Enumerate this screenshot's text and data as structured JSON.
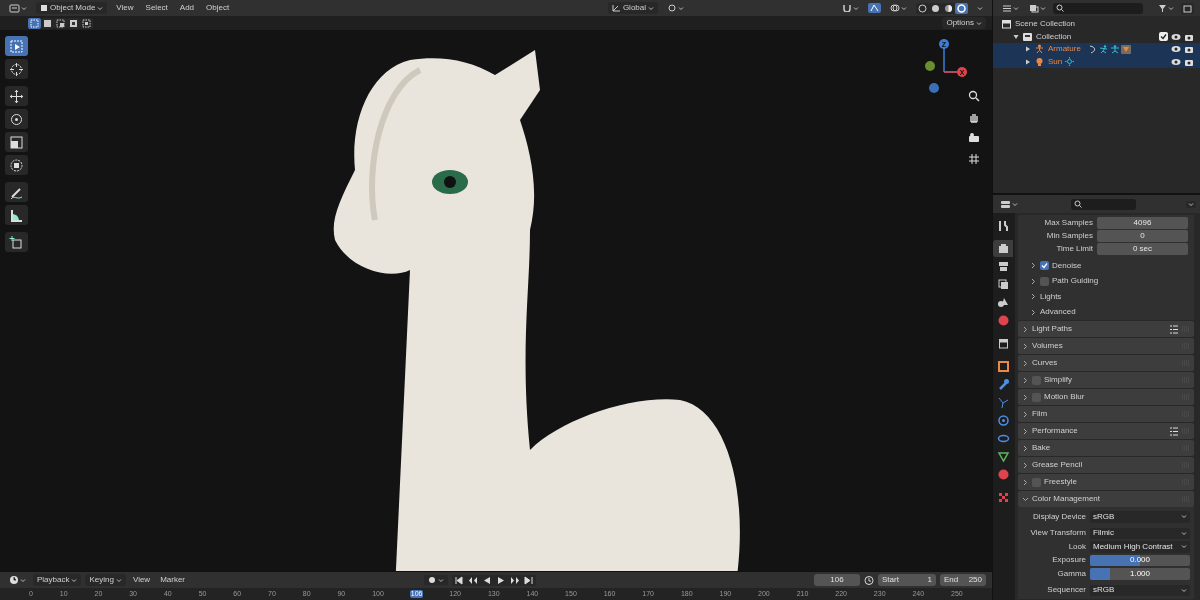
{
  "header": {
    "mode": "Object Mode",
    "menus": [
      "View",
      "Select",
      "Add",
      "Object"
    ],
    "orientation": "Global",
    "options": "Options"
  },
  "select_modes": [
    {
      "selected": true
    },
    {
      "selected": false
    },
    {
      "selected": false
    },
    {
      "selected": false
    },
    {
      "selected": false
    }
  ],
  "shading_modes": [
    {
      "selected": false
    },
    {
      "selected": false
    },
    {
      "selected": false
    },
    {
      "selected": true
    }
  ],
  "tools": [
    {
      "selected": true
    },
    {
      "selected": false
    },
    {
      "selected": false
    },
    {
      "selected": false
    },
    {
      "selected": false
    },
    {
      "selected": false
    },
    {
      "selected": false
    },
    {
      "selected": false
    },
    {
      "selected": false
    }
  ],
  "gizmo": {
    "axes": [
      "Z",
      "X"
    ]
  },
  "outliner": {
    "items": [
      {
        "name": "Scene Collection",
        "kind": "scene",
        "children": [
          {
            "name": "Collection",
            "kind": "collection",
            "checked": true,
            "children": [
              {
                "name": "Armature",
                "kind": "armature",
                "selected": true
              },
              {
                "name": "Sun",
                "kind": "light",
                "selected": true
              }
            ]
          }
        ]
      }
    ]
  },
  "properties": {
    "tabs": [
      {
        "selected": false
      },
      {
        "selected": true
      },
      {
        "selected": false
      },
      {
        "selected": false
      },
      {
        "selected": false
      },
      {
        "selected": false
      },
      {
        "selected": false
      },
      {
        "selected": false
      },
      {
        "selected": false
      },
      {
        "selected": false
      },
      {
        "selected": false
      },
      {
        "selected": false
      },
      {
        "selected": false
      },
      {
        "selected": false
      },
      {
        "selected": false
      }
    ],
    "fields": [
      {
        "label": "Max Samples",
        "value": "4096"
      },
      {
        "label": "Min Samples",
        "value": "0"
      },
      {
        "label": "Time Limit",
        "value": "0 sec"
      }
    ],
    "subpanels": [
      {
        "label": "Denoise",
        "kind": "toggle",
        "checked": true
      },
      {
        "label": "Path Guiding",
        "kind": "toggle",
        "checked": false
      },
      {
        "label": "Lights",
        "kind": "plain"
      },
      {
        "label": "Advanced",
        "kind": "plain"
      }
    ],
    "panels": [
      {
        "label": "Light Paths",
        "kind": "plain",
        "presets": true,
        "expanded": false
      },
      {
        "label": "Volumes",
        "kind": "plain",
        "presets": false,
        "expanded": false
      },
      {
        "label": "Curves",
        "kind": "plain",
        "presets": false,
        "expanded": false
      },
      {
        "label": "Simplify",
        "kind": "toggle",
        "checked": false,
        "presets": false,
        "expanded": false
      },
      {
        "label": "Motion Blur",
        "kind": "toggle",
        "checked": false,
        "presets": false,
        "expanded": false
      },
      {
        "label": "Film",
        "kind": "plain",
        "presets": false,
        "expanded": false
      },
      {
        "label": "Performance",
        "kind": "plain",
        "presets": true,
        "expanded": false
      },
      {
        "label": "Bake",
        "kind": "plain",
        "presets": false,
        "expanded": false
      },
      {
        "label": "Grease Pencil",
        "kind": "plain",
        "presets": false,
        "expanded": false
      },
      {
        "label": "Freestyle",
        "kind": "toggle",
        "checked": false,
        "presets": false,
        "expanded": false
      },
      {
        "label": "Color Management",
        "kind": "plain",
        "presets": false,
        "expanded": true,
        "rows": [
          {
            "label": "Display Device",
            "kind": "dropdown",
            "value": "sRGB"
          },
          {
            "label": "View Transform",
            "kind": "dropdown",
            "value": "Filmic"
          },
          {
            "label": "Look",
            "kind": "dropdown",
            "value": "Medium High Contrast"
          },
          {
            "label": "Exposure",
            "kind": "slider",
            "value": "0.000",
            "level": 0.5
          },
          {
            "label": "Gamma",
            "kind": "slider",
            "value": "1.000",
            "level": 0.2
          },
          {
            "label": "Sequencer",
            "kind": "dropdown",
            "value": "sRGB"
          }
        ]
      }
    ]
  },
  "timeline": {
    "menus": [
      {
        "label": "Playback",
        "dropdown": true
      },
      {
        "label": "Keying",
        "dropdown": true
      },
      {
        "label": "View",
        "dropdown": false
      },
      {
        "label": "Marker",
        "dropdown": false
      }
    ],
    "current_frame": "106",
    "start_label": "Start",
    "start": "1",
    "end_label": "End",
    "end": "250",
    "ruler": [
      {
        "label": "0",
        "selected": false
      },
      {
        "label": "10",
        "selected": false
      },
      {
        "label": "20",
        "selected": false
      },
      {
        "label": "30",
        "selected": false
      },
      {
        "label": "40",
        "selected": false
      },
      {
        "label": "50",
        "selected": false
      },
      {
        "label": "60",
        "selected": false
      },
      {
        "label": "70",
        "selected": false
      },
      {
        "label": "80",
        "selected": false
      },
      {
        "label": "90",
        "selected": false
      },
      {
        "label": "100",
        "selected": false
      },
      {
        "label": "106",
        "selected": true
      },
      {
        "label": "120",
        "selected": false
      },
      {
        "label": "130",
        "selected": false
      },
      {
        "label": "140",
        "selected": false
      },
      {
        "label": "150",
        "selected": false
      },
      {
        "label": "160",
        "selected": false
      },
      {
        "label": "170",
        "selected": false
      },
      {
        "label": "180",
        "selected": false
      },
      {
        "label": "190",
        "selected": false
      },
      {
        "label": "200",
        "selected": false
      },
      {
        "label": "210",
        "selected": false
      },
      {
        "label": "220",
        "selected": false
      },
      {
        "label": "230",
        "selected": false
      },
      {
        "label": "240",
        "selected": false
      },
      {
        "label": "250",
        "selected": false
      }
    ]
  }
}
